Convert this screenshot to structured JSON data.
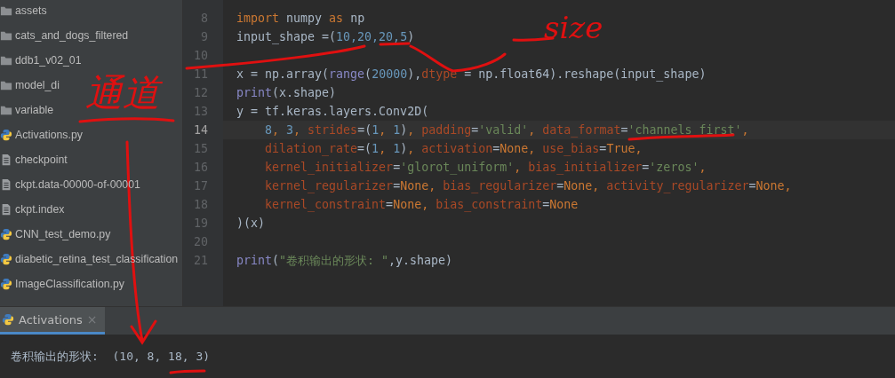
{
  "project_tree": [
    {
      "kind": "folder",
      "label": "assets"
    },
    {
      "kind": "folder",
      "label": "cats_and_dogs_filtered"
    },
    {
      "kind": "folder",
      "label": "ddb1_v02_01"
    },
    {
      "kind": "folder",
      "label": "model_di"
    },
    {
      "kind": "folder",
      "label": "variable"
    },
    {
      "kind": "python",
      "label": "Activations.py"
    },
    {
      "kind": "text",
      "label": "checkpoint"
    },
    {
      "kind": "text",
      "label": "ckpt.data-00000-of-00001"
    },
    {
      "kind": "text",
      "label": "ckpt.index"
    },
    {
      "kind": "python",
      "label": "CNN_test_demo.py"
    },
    {
      "kind": "python",
      "label": "diabetic_retina_test_classification"
    },
    {
      "kind": "python",
      "label": "ImageClassification.py"
    }
  ],
  "editor": {
    "lines": [
      {
        "number": "8",
        "current": false,
        "tokens": [
          {
            "kind": "keyword",
            "text": "import "
          },
          {
            "kind": "plain",
            "text": "numpy "
          },
          {
            "kind": "keyword",
            "text": "as "
          },
          {
            "kind": "plain",
            "text": "np"
          }
        ]
      },
      {
        "number": "9",
        "current": false,
        "tokens": [
          {
            "kind": "plain",
            "text": "input_shape =("
          },
          {
            "kind": "number",
            "text": "10,20,20,5"
          },
          {
            "kind": "plain",
            "text": ")"
          }
        ]
      },
      {
        "number": "10",
        "current": false
      },
      {
        "number": "11",
        "current": false,
        "tokens": [
          {
            "kind": "plain",
            "text": "x = np.array("
          },
          {
            "kind": "builtin",
            "text": "range"
          },
          {
            "kind": "plain",
            "text": "("
          },
          {
            "kind": "number",
            "text": "20000"
          },
          {
            "kind": "plain",
            "text": "),"
          },
          {
            "kind": "param",
            "text": "dtype"
          },
          {
            "kind": "plain",
            "text": " = np.float64).reshape(input_shape)"
          }
        ]
      },
      {
        "number": "12",
        "current": false,
        "tokens": [
          {
            "kind": "builtin",
            "text": "print"
          },
          {
            "kind": "plain",
            "text": "(x.shape)"
          }
        ]
      },
      {
        "number": "13",
        "current": false,
        "tokens": [
          {
            "kind": "plain",
            "text": "y = tf.keras.layers.Conv2D("
          }
        ]
      },
      {
        "number": "14",
        "current": true,
        "indent": true,
        "tokens": [
          {
            "kind": "number",
            "text": "8"
          },
          {
            "kind": "keyword",
            "text": ", "
          },
          {
            "kind": "number",
            "text": "3"
          },
          {
            "kind": "keyword",
            "text": ", "
          },
          {
            "kind": "param",
            "text": "strides"
          },
          {
            "kind": "plain",
            "text": "=("
          },
          {
            "kind": "number",
            "text": "1"
          },
          {
            "kind": "keyword",
            "text": ", "
          },
          {
            "kind": "number",
            "text": "1"
          },
          {
            "kind": "plain",
            "text": ")"
          },
          {
            "kind": "keyword",
            "text": ", "
          },
          {
            "kind": "param",
            "text": "padding"
          },
          {
            "kind": "plain",
            "text": "="
          },
          {
            "kind": "string",
            "text": "'valid'"
          },
          {
            "kind": "keyword",
            "text": ", "
          },
          {
            "kind": "param",
            "text": "data_format"
          },
          {
            "kind": "plain",
            "text": "="
          },
          {
            "kind": "string",
            "text": "'channels_first'"
          },
          {
            "kind": "keyword",
            "text": ","
          }
        ]
      },
      {
        "number": "15",
        "current": false,
        "indent": true,
        "tokens": [
          {
            "kind": "param",
            "text": "dilation_rate"
          },
          {
            "kind": "plain",
            "text": "=("
          },
          {
            "kind": "number",
            "text": "1"
          },
          {
            "kind": "keyword",
            "text": ", "
          },
          {
            "kind": "number",
            "text": "1"
          },
          {
            "kind": "plain",
            "text": ")"
          },
          {
            "kind": "keyword",
            "text": ", "
          },
          {
            "kind": "param",
            "text": "activation"
          },
          {
            "kind": "plain",
            "text": "="
          },
          {
            "kind": "keyword",
            "text": "None, "
          },
          {
            "kind": "param",
            "text": "use_bias"
          },
          {
            "kind": "plain",
            "text": "="
          },
          {
            "kind": "keyword",
            "text": "True,"
          }
        ]
      },
      {
        "number": "16",
        "current": false,
        "indent": true,
        "tokens": [
          {
            "kind": "param",
            "text": "kernel_initializer"
          },
          {
            "kind": "plain",
            "text": "="
          },
          {
            "kind": "string",
            "text": "'glorot_uniform'"
          },
          {
            "kind": "keyword",
            "text": ", "
          },
          {
            "kind": "param",
            "text": "bias_initializer"
          },
          {
            "kind": "plain",
            "text": "="
          },
          {
            "kind": "string",
            "text": "'zeros'"
          },
          {
            "kind": "keyword",
            "text": ","
          }
        ]
      },
      {
        "number": "17",
        "current": false,
        "indent": true,
        "tokens": [
          {
            "kind": "param",
            "text": "kernel_regularizer"
          },
          {
            "kind": "plain",
            "text": "="
          },
          {
            "kind": "keyword",
            "text": "None, "
          },
          {
            "kind": "param",
            "text": "bias_regularizer"
          },
          {
            "kind": "plain",
            "text": "="
          },
          {
            "kind": "keyword",
            "text": "None, "
          },
          {
            "kind": "param",
            "text": "activity_regularizer"
          },
          {
            "kind": "plain",
            "text": "="
          },
          {
            "kind": "keyword",
            "text": "None,"
          }
        ]
      },
      {
        "number": "18",
        "current": false,
        "indent": true,
        "tokens": [
          {
            "kind": "param",
            "text": "kernel_constraint"
          },
          {
            "kind": "plain",
            "text": "="
          },
          {
            "kind": "keyword",
            "text": "None, "
          },
          {
            "kind": "param",
            "text": "bias_constraint"
          },
          {
            "kind": "plain",
            "text": "="
          },
          {
            "kind": "keyword",
            "text": "None"
          }
        ]
      },
      {
        "number": "19",
        "current": false,
        "tokens": [
          {
            "kind": "plain",
            "text": ")(x)"
          }
        ]
      },
      {
        "number": "20",
        "current": false
      },
      {
        "number": "21",
        "current": false,
        "tokens": [
          {
            "kind": "builtin",
            "text": "print"
          },
          {
            "kind": "plain",
            "text": "("
          },
          {
            "kind": "string",
            "text": "\"卷积输出的形状: \""
          },
          {
            "kind": "plain",
            "text": ",y.shape)"
          }
        ]
      }
    ]
  },
  "run_panel": {
    "tabs": [
      {
        "label": "Activations",
        "selected": true,
        "close": "×"
      }
    ],
    "output": "卷积输出的形状:  (10, 8, 18, 3)"
  },
  "annotations": [
    {
      "text": "size"
    },
    {
      "text": "通道"
    }
  ]
}
